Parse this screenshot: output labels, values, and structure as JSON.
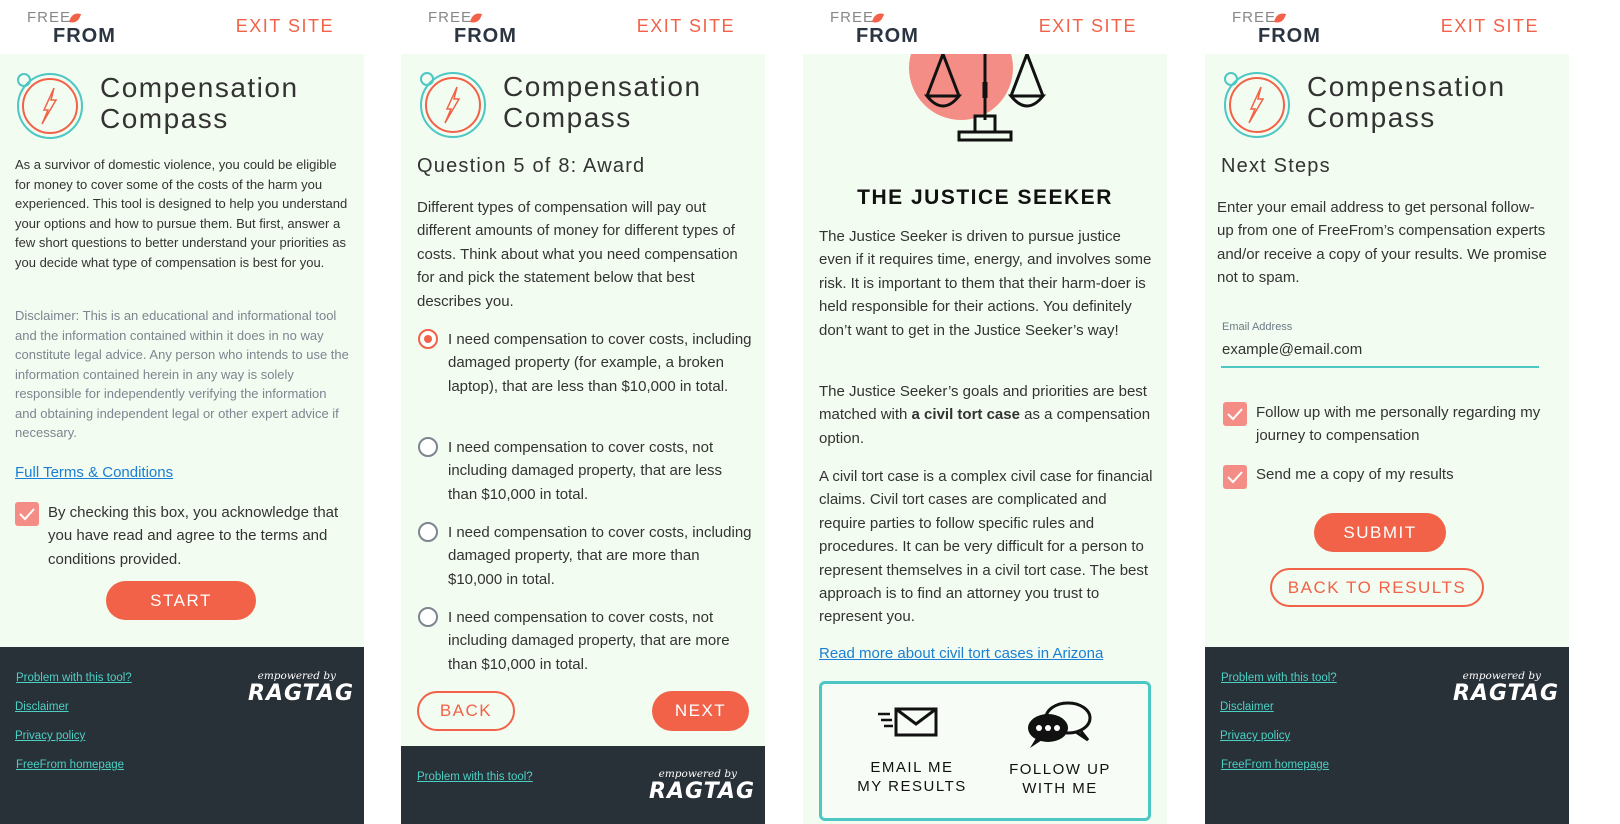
{
  "common": {
    "logo_top": "FREE",
    "logo_bottom": "FROM",
    "exit_label": "EXIT SITE",
    "tool_title_line1": "Compensation",
    "tool_title_line2": "Compass"
  },
  "footer": {
    "problem": "Problem with this tool?",
    "disclaimer": "Disclaimer",
    "privacy": "Privacy policy",
    "homepage": "FreeFrom homepage",
    "empowered_by": "empowered by",
    "ragtag": "RAGTAG"
  },
  "intro": {
    "body": "As a survivor of domestic violence, you could be eligible for money to cover some of the costs of the harm you experienced. This tool is designed to help you understand your options and how to pursue them. But first, answer a few short questions to better understand your priorities as you decide what type of compensation is best for you.",
    "disclaimer": "Disclaimer: This is an educational and informational tool and the information contained within it does in no way constitute legal advice. Any person who intends to use the information contained herein in any way is solely responsible for independently verifying the information and obtaining independent legal or other expert advice if necessary.",
    "terms_link": "Full Terms & Conditions",
    "agree_text": "By checking this box, you acknowledge that you have read and agree to the terms and conditions provided.",
    "start_label": "START"
  },
  "question": {
    "heading": "Question 5 of 8: Award",
    "prompt": "Different types of compensation will pay out different amounts of money for different types of costs. Think about what you need compensation for and pick the statement below that best describes you.",
    "options": [
      {
        "label": "I need compensation to cover costs, including damaged property (for example, a broken laptop), that are less than $10,000 in total.",
        "selected": true
      },
      {
        "label": "I need compensation to cover costs, not including damaged property, that are less than $10,000 in total.",
        "selected": false
      },
      {
        "label": "I need compensation to cover costs, including damaged property, that are more than $10,000 in total.",
        "selected": false
      },
      {
        "label": "I need compensation to cover costs, not including damaged property, that are more than $10,000 in total.",
        "selected": false
      }
    ],
    "back_label": "BACK",
    "next_label": "NEXT"
  },
  "result": {
    "title": "THE JUSTICE SEEKER",
    "para1": "The Justice Seeker is driven to pursue justice even if it requires time, energy, and involves some risk. It is important to them that their harm-doer is held responsible for their actions. You definitely don’t want to get in the Justice Seeker’s way!",
    "para2_before": "The Justice Seeker’s goals and priorities are best matched with ",
    "para2_bold": "a civil tort case",
    "para2_after": " as a compensation option.",
    "para3": "A civil tort case is a complex civil case for financial claims. Civil tort cases are complicated and require parties to follow specific rules and procedures. It can be very difficult for a person to represent themselves in a civil tort case. The best approach is to find an attorney you trust to represent you.",
    "read_more_link": "Read more about civil tort cases in Arizona",
    "email_line1": "EMAIL ME",
    "email_line2": "MY RESULTS",
    "follow_line1": "FOLLOW UP",
    "follow_line2": "WITH ME"
  },
  "next_steps": {
    "heading": "Next Steps",
    "body": "Enter your email address to get personal follow-up from one of FreeFrom’s compensation experts and/or receive a copy of your results. We promise not to spam.",
    "email_label": "Email Address",
    "email_value": "example@email.com",
    "followup_text": "Follow up with me personally regarding my journey to compensation",
    "copy_text": "Send me a copy of my results",
    "submit_label": "SUBMIT",
    "back_label": "BACK TO RESULTS"
  },
  "colors": {
    "accent": "#f16248",
    "teal": "#4dc7c4",
    "panel_bg": "#f3fcf0",
    "footer_bg": "#283038",
    "check_bg": "#f48d85"
  }
}
